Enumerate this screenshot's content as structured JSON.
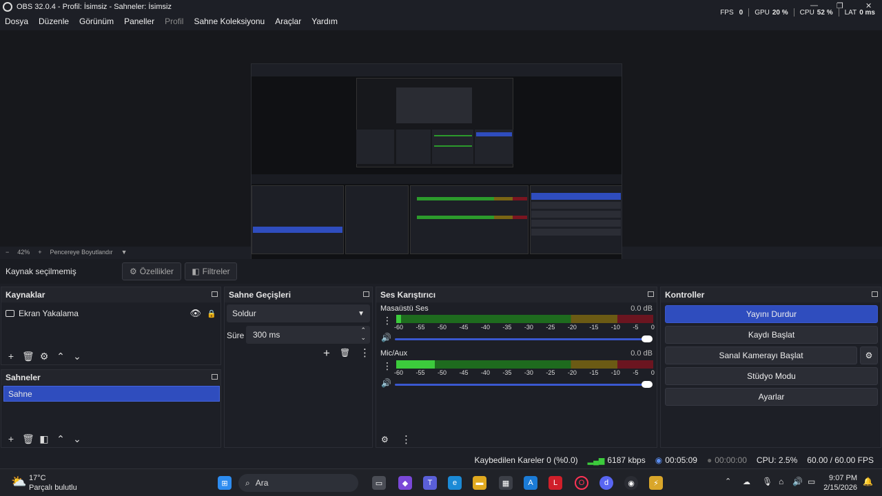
{
  "window": {
    "title": "OBS 32.0.4 - Profil: İsimsiz - Sahneler: İsimsiz"
  },
  "menu": [
    "Dosya",
    "Düzenle",
    "Görünüm",
    "Paneller",
    "Profil",
    "Sahne Koleksiyonu",
    "Araçlar",
    "Yardım"
  ],
  "stats": {
    "fps_label": "FPS",
    "fps": "0",
    "gpu_label": "GPU",
    "gpu": "20 %",
    "cpu_label": "CPU",
    "cpu": "52 %",
    "lat_label": "LAT",
    "lat": "0 ms"
  },
  "zoom": {
    "minus": "−",
    "value": "42%",
    "plus": "+",
    "mode": "Pencereye Boyutlandır"
  },
  "sourcebar": {
    "label": "Kaynak seçilmemiş",
    "properties": "Özellikler",
    "filters": "Filtreler"
  },
  "sources": {
    "title": "Kaynaklar",
    "items": [
      {
        "label": "Ekran Yakalama"
      }
    ]
  },
  "scenes": {
    "title": "Sahneler",
    "items": [
      {
        "label": "Sahne"
      }
    ]
  },
  "transitions": {
    "title": "Sahne Geçişleri",
    "selected": "Soldur",
    "duration_label": "Süre",
    "duration": "300 ms"
  },
  "mixer": {
    "title": "Ses Karıştırıcı",
    "channels": [
      {
        "name": "Masaüstü Ses",
        "db": "0.0 dB",
        "level": 0.02
      },
      {
        "name": "Mic/Aux",
        "db": "0.0 dB",
        "level": 0.15
      }
    ],
    "ticks": [
      "-60",
      "-55",
      "-50",
      "-45",
      "-40",
      "-35",
      "-30",
      "-25",
      "-20",
      "-15",
      "-10",
      "-5",
      "0"
    ]
  },
  "controls": {
    "title": "Kontroller",
    "stop_stream": "Yayını Durdur",
    "start_record": "Kaydı Başlat",
    "start_vcam": "Sanal Kamerayı Başlat",
    "studio_mode": "Stüdyo Modu",
    "settings": "Ayarlar"
  },
  "status": {
    "dropped": "Kaybedilen Kareler 0 (%0.0)",
    "bitrate": "6187 kbps",
    "stream_time": "00:05:09",
    "rec_time": "00:00:00",
    "cpu": "CPU: 2.5%",
    "fps": "60.00 / 60.00 FPS"
  },
  "taskbar": {
    "weather_temp": "17°C",
    "weather_desc": "Parçalı bulutlu",
    "search": "Ara",
    "time": "9:07 PM",
    "date": "2/15/2026"
  },
  "colors": {
    "accent": "#2f4dbe",
    "bg": "#1d1f26",
    "meter_green": "#3ccb3c"
  }
}
